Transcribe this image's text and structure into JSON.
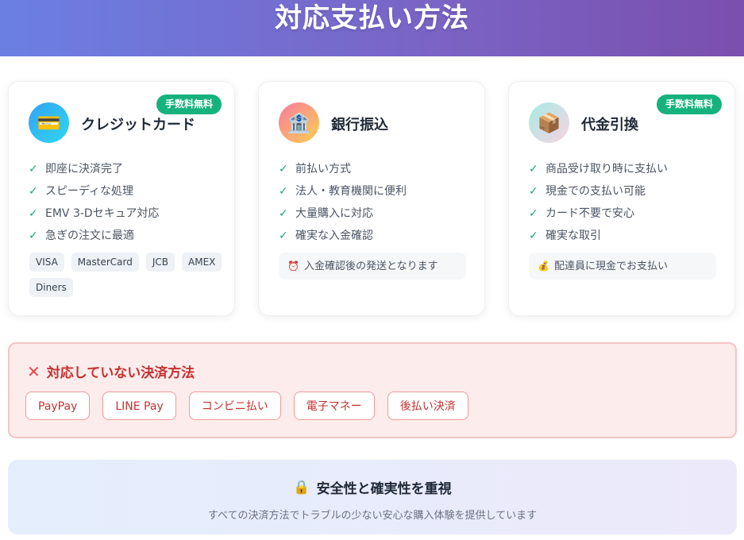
{
  "header": {
    "title": "対応支払い方法"
  },
  "cards": [
    {
      "title": "クレジットカード",
      "icon": "credit-card-icon",
      "icon_glyph": "💳",
      "badge": "手数料無料",
      "features": [
        "即座に決済完了",
        "スピーディな処理",
        "EMV 3-Dセキュア対応",
        "急ぎの注文に最適"
      ],
      "brands": [
        "VISA",
        "MasterCard",
        "JCB",
        "AMEX",
        "Diners"
      ]
    },
    {
      "title": "銀行振込",
      "icon": "bank-icon",
      "icon_glyph": "🏦",
      "features": [
        "前払い方式",
        "法人・教育機関に便利",
        "大量購入に対応",
        "確実な入金確認"
      ],
      "note": {
        "icon": "alarm-clock-icon",
        "glyph": "⏰",
        "text": "入金確認後の発送となります"
      }
    },
    {
      "title": "代金引換",
      "icon": "package-icon",
      "icon_glyph": "📦",
      "badge": "手数料無料",
      "features": [
        "商品受け取り時に支払い",
        "現金での支払い可能",
        "カード不要で安心",
        "確実な取引"
      ],
      "note": {
        "icon": "money-bag-icon",
        "glyph": "💰",
        "text": "配達員に現金でお支払い"
      }
    }
  ],
  "check_mark": "✓",
  "unsupported": {
    "icon_glyph": "✕",
    "title": "対応していない決済方法",
    "items": [
      "PayPay",
      "LINE Pay",
      "コンビニ払い",
      "電子マネー",
      "後払い決済"
    ]
  },
  "safety": {
    "icon_glyph": "🔒",
    "title": "安全性と確実性を重視",
    "description": "すべての決済方法でトラブルの少ない安心な購入体験を提供しています"
  },
  "colors": {
    "accent_green": "#16b27d",
    "header_gradient_start": "#6b7fe3",
    "header_gradient_end": "#7a4fae",
    "warning_red": "#c53030"
  }
}
